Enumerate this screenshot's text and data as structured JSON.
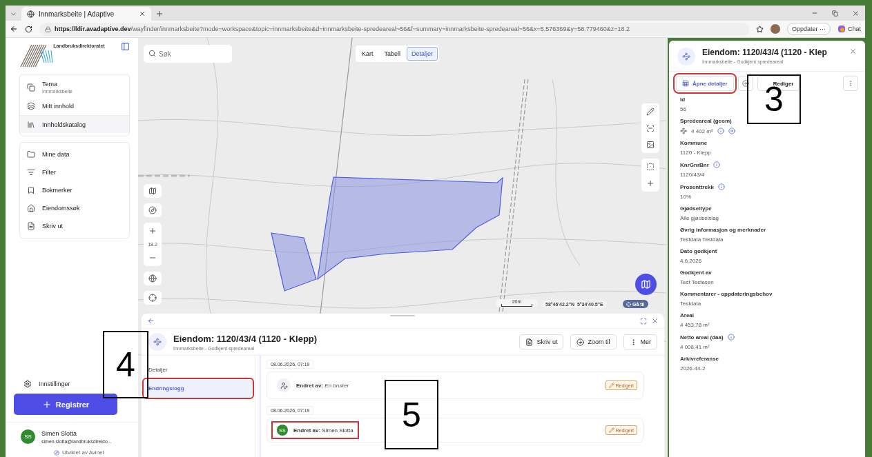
{
  "browser": {
    "tab_title": "Innmarksbeite | Adaptive",
    "url_host": "https://ldir.avadaptive.dev",
    "url_path": "/wayfinder/innmarksbeite?mode=workspace&topic=innmarksbeite&d=innmarksbeite-spredeareal~56&f=summary~innmarksbeite-spredeareal~56&x=5.576369&y=58.779460&z=18.2",
    "update_button": "Oppdater ···",
    "chat_button": "Chat"
  },
  "sidebar": {
    "logo_text": "Landbruksdirektoratet",
    "group_1": [
      {
        "kind": "theme",
        "label": "Tema",
        "sublabel": "Innmarksbeite",
        "selected": false
      },
      {
        "kind": "layers",
        "label": "Mitt innhold",
        "selected": false
      },
      {
        "kind": "library",
        "label": "Innholdskatalog",
        "selected": true
      }
    ],
    "group_2": [
      {
        "kind": "folder",
        "label": "Mine data"
      },
      {
        "kind": "filter",
        "label": "Filter"
      },
      {
        "kind": "bookmark",
        "label": "Bokmerker"
      },
      {
        "kind": "property",
        "label": "Eiendomssøk"
      },
      {
        "kind": "print",
        "label": "Skriv ut"
      }
    ],
    "settings": "Innstillinger",
    "register_button": "Registrer",
    "user": {
      "initials": "SS",
      "name": "Simen Slotta",
      "email": "simen.slotta@landbruksdirekto..."
    },
    "footer": "Utviklet av Avinet"
  },
  "map": {
    "search": {
      "placeholder": "Søk"
    },
    "view_tabs": [
      {
        "label": "Kart",
        "selected": false
      },
      {
        "label": "Tabell",
        "selected": false
      },
      {
        "label": "Detaljer",
        "selected": true
      }
    ],
    "zoom_level": "18.2",
    "scale": "20m",
    "coordinates": "58°46'42.2\"N  5°34'40.5\"E",
    "goto_button": "Gå til"
  },
  "bottom_panel": {
    "title": "Eiendom: 1120/43/4 (1120 - Klepp)",
    "subtitle": "Innmarksbeite - Godkjent spredeareal",
    "buttons": [
      {
        "kind": "print",
        "label": "Skriv ut"
      },
      {
        "kind": "zoom",
        "label": "Zoom til"
      },
      {
        "kind": "more",
        "label": "Mer"
      }
    ],
    "tabs": [
      {
        "label": "Detaljer",
        "selected": false,
        "highlighted": false
      },
      {
        "label": "Endringslogg",
        "selected": true,
        "highlighted": true
      }
    ],
    "log": [
      {
        "time": "08.06.2026, 07:19",
        "label": "Endret av:",
        "user": "En bruker",
        "kind": "icon",
        "badge": "Redigert",
        "highlighted": false
      },
      {
        "time": "08.06.2026, 07:19",
        "label": "Endret av:",
        "user": "Simen Slotta",
        "kind": "initials",
        "initials": "SS",
        "badge": "Redigert",
        "highlighted": true
      }
    ]
  },
  "detail_panel": {
    "title": "Eiendom: 1120/43/4 (1120 - Klep",
    "subtitle": "Innmarksbeite - Godkjent spredeareal",
    "open_button": {
      "label": "Åpne detaljer",
      "highlighted": true
    },
    "edit_button": "Rediger",
    "fields": [
      {
        "label": "Id",
        "value": "56",
        "info": false,
        "kind": "text"
      },
      {
        "label": "Spredeareal (geom)",
        "value": "4 402 m²",
        "info": true,
        "kind": "geometry"
      },
      {
        "label": "Kommune",
        "value": "1120 - Klepp",
        "info": false,
        "kind": "text"
      },
      {
        "label": "KnrGnrBnr",
        "value": "1120/43/4",
        "info": true,
        "kind": "text"
      },
      {
        "label": "Prosenttrekk",
        "value": "10%",
        "info": true,
        "kind": "text"
      },
      {
        "label": "Gjødseltype",
        "value": "Alle gjødselslag",
        "info": false,
        "kind": "text"
      },
      {
        "label": "Øvrig informasjon og merknader",
        "value": "Testdata Testdata",
        "info": false,
        "kind": "text"
      },
      {
        "label": "Dato godkjent",
        "value": "4.6.2026",
        "info": false,
        "kind": "text"
      },
      {
        "label": "Godkjent av",
        "value": "Test Testesen",
        "info": false,
        "kind": "text"
      },
      {
        "label": "Kommentarer - oppdateringsbehov",
        "value": "Testdata",
        "info": false,
        "kind": "text"
      },
      {
        "label": "Areal",
        "value": "4 453,78 m²",
        "info": false,
        "kind": "text"
      },
      {
        "label": "Netto areal (daa)",
        "value": "4 008,41 m²",
        "info": true,
        "kind": "text"
      },
      {
        "label": "Arkivreferanse",
        "value": "2026-44-2",
        "info": false,
        "kind": "text"
      }
    ]
  },
  "annotations": [
    "3",
    "4",
    "5"
  ]
}
